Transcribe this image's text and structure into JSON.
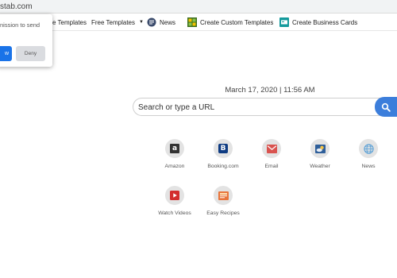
{
  "address_bar": {
    "url_fragment": "stab.com"
  },
  "toolbar": {
    "items": [
      {
        "label": "e Templates",
        "icon": "templates-icon"
      },
      {
        "label": "Free Templates",
        "icon": "chevron-down-icon"
      },
      {
        "label": "News",
        "icon": "news-icon"
      },
      {
        "label": "Create Custom Templates",
        "icon": "custom-templates-icon"
      },
      {
        "label": "Create Business Cards",
        "icon": "business-cards-icon"
      }
    ]
  },
  "notification_popup": {
    "text": "nission to send",
    "allow_label": "w",
    "deny_label": "Deny"
  },
  "datetime": {
    "text": "March 17, 2020 | 11:56 AM"
  },
  "search": {
    "placeholder": "Search or type a URL",
    "icon": "search-icon"
  },
  "tiles": [
    {
      "label": "Amazon",
      "icon": "amazon-icon",
      "color": "#333333"
    },
    {
      "label": "Booking.com",
      "icon": "booking-icon",
      "color": "#0e3b82"
    },
    {
      "label": "Email",
      "icon": "email-icon",
      "color": "#d9534f"
    },
    {
      "label": "Weather",
      "icon": "weather-icon",
      "color": "#2f5f9a"
    },
    {
      "label": "News",
      "icon": "globe-icon",
      "color": "#5aa0d6"
    },
    {
      "label": "Watch Videos",
      "icon": "video-play-icon",
      "color": "#d32f2f"
    },
    {
      "label": "Easy Recipes",
      "icon": "recipes-icon",
      "color": "#e8743b"
    }
  ]
}
